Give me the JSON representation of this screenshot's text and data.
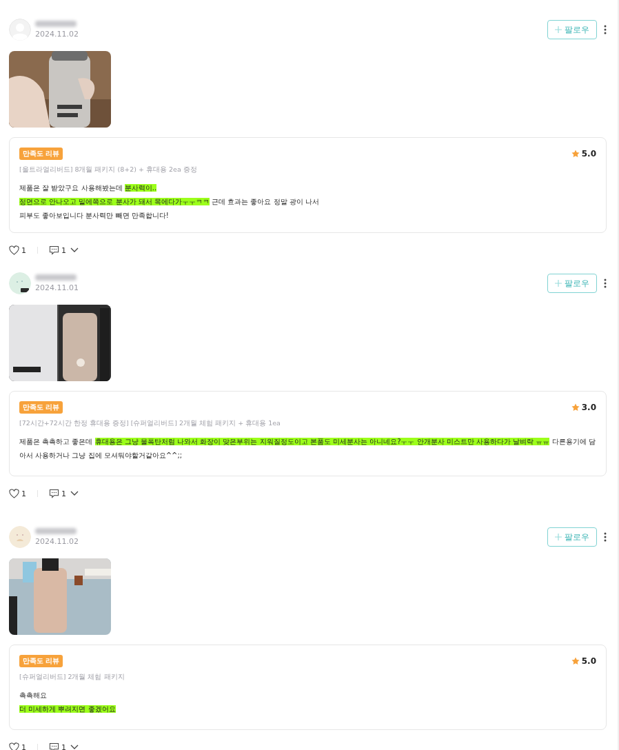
{
  "reviews": [
    {
      "date": "2024.11.02",
      "follow_label": "팔로우",
      "badge": "만족도 리뷰",
      "rating": "5.0",
      "option": "[울트라얼리버드] 8개월 패키지 (8+2) + 휴대용 2ea 증정",
      "body": [
        [
          {
            "text": "제품은 잘 받았구요 사용해봤는데 ",
            "highlighted": false
          },
          {
            "text": "분사력이..",
            "highlighted": true
          }
        ],
        [
          {
            "text": "정면으로 안나오고 밑에쪽으로 분사가 돼서 목에다가ㅜㅜㅋㅋ",
            "highlighted": true
          },
          {
            "text": " 근데  효과는 좋아요 정말 광이 나서",
            "highlighted": false
          }
        ],
        [
          {
            "text": "피부도 좋아보입니다 분사력만 빼면 만족합니다!",
            "highlighted": false
          }
        ]
      ],
      "likes": "1",
      "comments": "1"
    },
    {
      "date": "2024.11.01",
      "follow_label": "팔로우",
      "badge": "만족도 리뷰",
      "rating": "3.0",
      "option": "[72시간+72시간 한정 휴대용 증정] [슈퍼얼리버드] 2개월 체험 패키지 + 휴대용 1ea",
      "body": [
        [
          {
            "text": "제품은 촉촉하고 좋은데 ",
            "highlighted": false
          },
          {
            "text": "휴대용은 그냥 물폭탄처럼 나와서 화장이 맞은부위는 지워질정도이고 본품도 미세분사는 아니네요?ㅜㅜ 안개분사 미스트만 사용하다가 날벼락 ㅠㅠ",
            "highlighted": true
          },
          {
            "text": " 다른용기에 담아서 사용하거나 그냥 집에 모셔둬야할거같아요^^;;",
            "highlighted": false
          }
        ]
      ],
      "likes": "1",
      "comments": "1"
    },
    {
      "date": "2024.11.02",
      "follow_label": "팔로우",
      "badge": "만족도 리뷰",
      "rating": "5.0",
      "option": "[슈퍼얼리버드] 2개월 체험 패키지",
      "body": [
        [
          {
            "text": "촉촉해요",
            "highlighted": false
          }
        ],
        [
          {
            "text": "더 미세하게 뿌려지면 좋겠어요",
            "highlighted": true
          }
        ]
      ],
      "likes": "1",
      "comments": "1"
    }
  ]
}
